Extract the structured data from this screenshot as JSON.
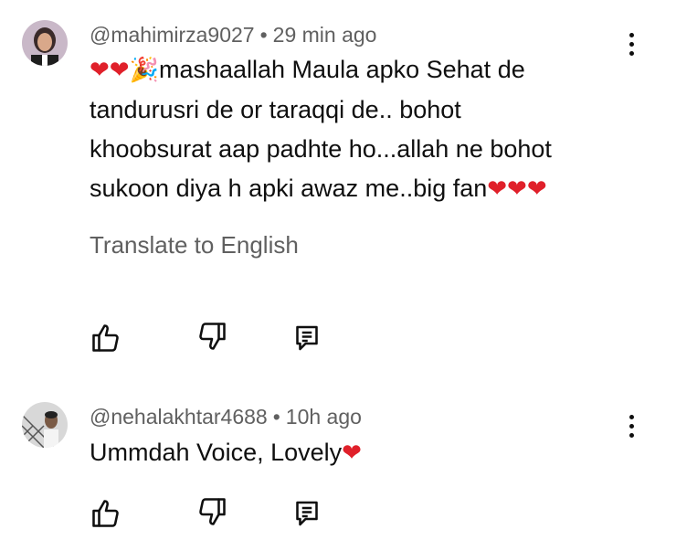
{
  "comments": [
    {
      "handle": "@mahimirza9027",
      "separator": "•",
      "time": "29 min ago",
      "text_line1_prefix_emoji": "❤❤🎉",
      "lines": [
        "mashaallah Maula apko Sehat de",
        "tandurusri de or taraqqi de.. bohot",
        "khoobsurat aap padhte ho...allah ne bohot",
        "sukoon diya h apki awaz me..big fan"
      ],
      "trailing_emoji": "❤❤❤",
      "translate_label": "Translate to English",
      "icons": {
        "like": "thumbs-up-icon",
        "dislike": "thumbs-down-icon",
        "reply": "reply-icon",
        "more": "more-vertical-icon"
      }
    },
    {
      "handle": "@nehalakhtar4688",
      "separator": "•",
      "time": "10h ago",
      "text": "Ummdah Voice, Lovely",
      "trailing_emoji": "❤",
      "icons": {
        "like": "thumbs-up-icon",
        "dislike": "thumbs-down-icon",
        "reply": "reply-icon",
        "more": "more-vertical-icon"
      }
    }
  ],
  "colors": {
    "text_primary": "#0f0f0f",
    "text_secondary": "#606060",
    "heart": "#e0202a"
  }
}
